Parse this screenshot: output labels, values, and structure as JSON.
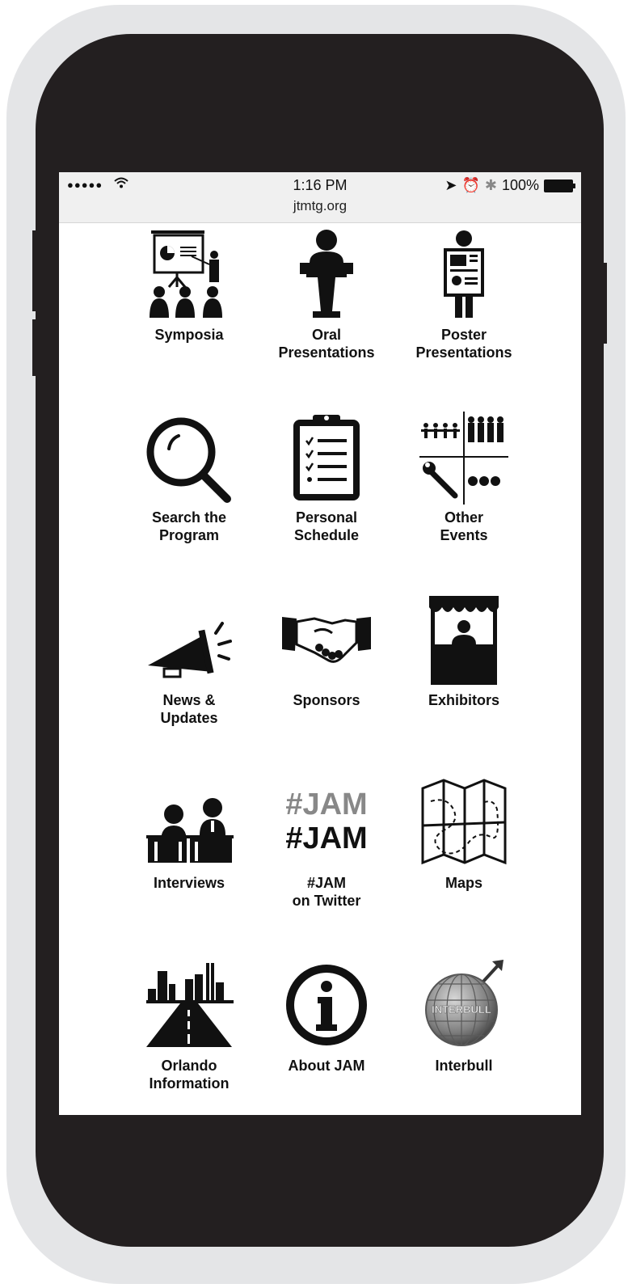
{
  "status_bar": {
    "signal": "●●●●●",
    "time": "1:16 PM",
    "url": "jtmtg.org",
    "battery": "100%"
  },
  "menu": [
    {
      "label": "Symposia",
      "icon": "presentation-icon"
    },
    {
      "label": "Oral\nPresentations",
      "icon": "podium-icon"
    },
    {
      "label": "Poster\nPresentations",
      "icon": "poster-person-icon"
    },
    {
      "label": "Search the\nProgram",
      "icon": "magnifier-icon"
    },
    {
      "label": "Personal\nSchedule",
      "icon": "clipboard-icon"
    },
    {
      "label": "Other\nEvents",
      "icon": "events-grid-icon"
    },
    {
      "label": "News &\nUpdates",
      "icon": "megaphone-icon"
    },
    {
      "label": "Sponsors",
      "icon": "handshake-icon"
    },
    {
      "label": "Exhibitors",
      "icon": "booth-icon"
    },
    {
      "label": "Interviews",
      "icon": "interview-icon"
    },
    {
      "label": "#JAM\non Twitter",
      "icon": "hashtag-icon"
    },
    {
      "label": "Maps",
      "icon": "map-icon"
    },
    {
      "label": "Orlando\nInformation",
      "icon": "city-road-icon"
    },
    {
      "label": "About JAM",
      "icon": "info-icon"
    },
    {
      "label": "Interbull",
      "icon": "globe-icon"
    }
  ],
  "icon_text": {
    "hashtag_top": "#JAM",
    "hashtag_bottom": "#JAM",
    "globe": "INTERBULL"
  },
  "colors": {
    "phone_body": "#231f20",
    "phone_frame": "#e4e5e7",
    "icon": "#111111"
  }
}
